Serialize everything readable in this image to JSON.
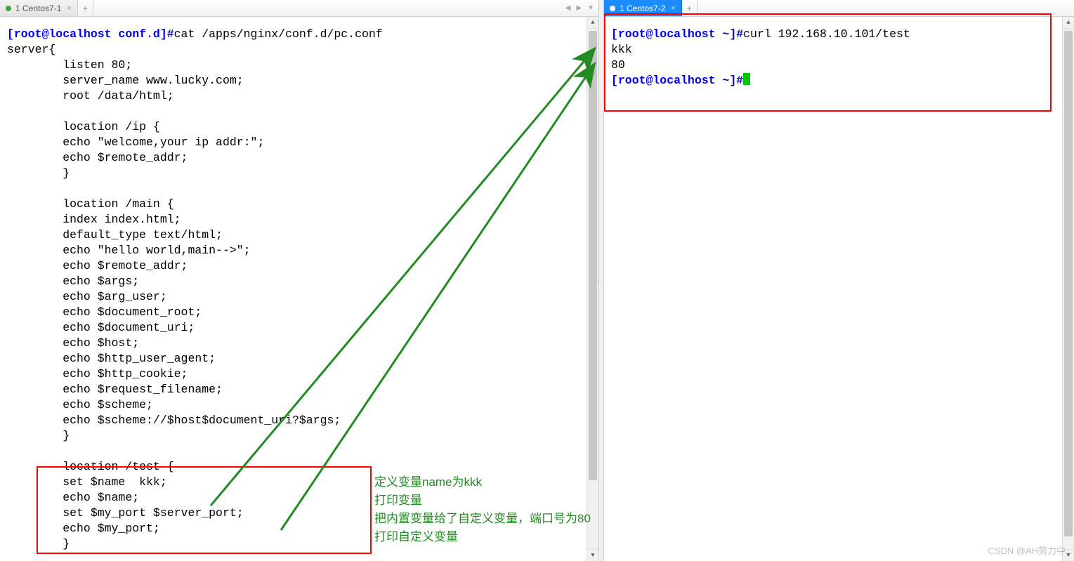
{
  "left": {
    "tab_label": "1 Centos7-1",
    "prompt": "[root@localhost conf.d]#",
    "cmd": "cat /apps/nginx/conf.d/pc.conf",
    "lines": [
      "server{",
      "        listen 80;",
      "        server_name www.lucky.com;",
      "        root /data/html;",
      "",
      "        location /ip {",
      "        echo \"welcome,your ip addr:\";",
      "        echo $remote_addr;",
      "        }",
      "",
      "        location /main {",
      "        index index.html;",
      "        default_type text/html;",
      "        echo \"hello world,main-->\";",
      "        echo $remote_addr;",
      "        echo $args;",
      "        echo $arg_user;",
      "        echo $document_root;",
      "        echo $document_uri;",
      "        echo $host;",
      "        echo $http_user_agent;",
      "        echo $http_cookie;",
      "        echo $request_filename;",
      "        echo $scheme;",
      "        echo $scheme://$host$document_uri?$args;",
      "        }",
      "",
      "        location /test {",
      "        set $name  kkk;",
      "        echo $name;",
      "        set $my_port $server_port;",
      "        echo $my_port;",
      "        }"
    ]
  },
  "right": {
    "tab_label": "1 Centos7-2",
    "prompt": "[root@localhost ~]#",
    "cmd": "curl 192.168.10.101/test",
    "out1": "kkk",
    "out2": "80"
  },
  "ann": {
    "a1": "定义变量name为kkk",
    "a2": "打印变量",
    "a3": "把内置变量给了自定义变量，端口号为80",
    "a4": "打印自定义变量"
  },
  "watermark": "CSDN @AH努力中",
  "icons": {
    "close": "×",
    "add": "+",
    "left_arrow": "◀",
    "right_arrow": "▶",
    "down_arrow": "▼",
    "up_tri": "▲",
    "down_tri": "▼"
  }
}
